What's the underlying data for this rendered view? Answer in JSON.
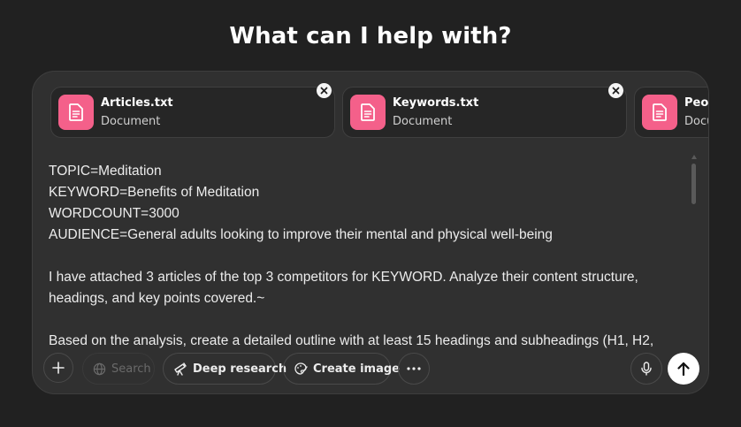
{
  "headline": "What can I help with?",
  "attachments": [
    {
      "name": "Articles.txt",
      "type": "Document",
      "icon": "document-icon"
    },
    {
      "name": "Keywords.txt",
      "type": "Document",
      "icon": "document-icon"
    },
    {
      "name": "People",
      "type": "Docu",
      "icon": "document-icon"
    }
  ],
  "prompt_lines": [
    "TOPIC=Meditation",
    "KEYWORD=Benefits of Meditation",
    "WORDCOUNT=3000",
    "AUDIENCE=General adults looking to improve their mental and physical well-being",
    "",
    "I have attached 3 articles of the top 3 competitors for KEYWORD. Analyze their content structure,",
    "headings, and key points covered.~",
    "",
    "Based on the analysis, create a detailed outline with at least 15 headings and subheadings (H1, H2,"
  ],
  "toolbar": {
    "add_icon": "plus-icon",
    "search_label": "Search",
    "search_icon": "globe-icon",
    "deep_research_label": "Deep research",
    "deep_research_icon": "telescope-icon",
    "create_image_label": "Create image",
    "create_image_icon": "palette-brush-icon",
    "more_icon": "more-horizontal-icon",
    "mic_icon": "microphone-icon",
    "send_icon": "arrow-up-icon"
  },
  "colors": {
    "background": "#212121",
    "composer": "#303030",
    "file_icon_accent": "#f4608a",
    "send_button": "#ffffff"
  }
}
